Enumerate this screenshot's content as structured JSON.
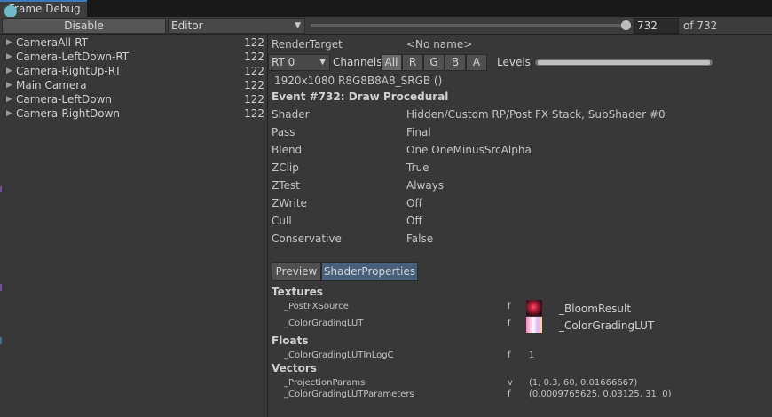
{
  "window": {
    "title": "Frame Debug"
  },
  "toolbar": {
    "disable_label": "Disable",
    "target_value": "Editor",
    "event_index": "732",
    "of_total": "of 732"
  },
  "tree": {
    "items": [
      {
        "name": "CameraAll-RT",
        "count": "122"
      },
      {
        "name": "Camera-LeftDown-RT",
        "count": "122"
      },
      {
        "name": "Camera-RightUp-RT",
        "count": "122"
      },
      {
        "name": "Main Camera",
        "count": "122"
      },
      {
        "name": "Camera-LeftDown",
        "count": "122"
      },
      {
        "name": "Camera-RightDown",
        "count": "122"
      }
    ]
  },
  "details": {
    "render_target_label": "RenderTarget",
    "render_target_value": "<No name>",
    "rt_select": "RT 0",
    "channels_label": "Channels",
    "channels": [
      "All",
      "R",
      "G",
      "B",
      "A"
    ],
    "levels_label": "Levels",
    "format": "1920x1080 R8G8B8A8_SRGB ()",
    "event_title": "Event #732: Draw Procedural",
    "properties": [
      {
        "label": "Shader",
        "value": "Hidden/Custom RP/Post FX Stack, SubShader #0"
      },
      {
        "label": "Pass",
        "value": "Final"
      },
      {
        "label": "Blend",
        "value": "One OneMinusSrcAlpha"
      },
      {
        "label": "ZClip",
        "value": "True"
      },
      {
        "label": "ZTest",
        "value": "Always"
      },
      {
        "label": "ZWrite",
        "value": "Off"
      },
      {
        "label": "Cull",
        "value": "Off"
      },
      {
        "label": "Conservative",
        "value": "False"
      }
    ],
    "tabs": [
      "Preview",
      "ShaderProperties"
    ],
    "textures_label": "Textures",
    "textures": [
      {
        "name": "_PostFXSource",
        "type": "f",
        "value": "_BloomResult"
      },
      {
        "name": "_ColorGradingLUT",
        "type": "f",
        "value": "_ColorGradingLUT"
      }
    ],
    "floats_label": "Floats",
    "floats": [
      {
        "name": "_ColorGradingLUTInLogC",
        "type": "f",
        "value": "1"
      }
    ],
    "vectors_label": "Vectors",
    "vectors": [
      {
        "name": "_ProjectionParams",
        "type": "v",
        "value": "(1, 0.3, 60, 0.01666667)"
      },
      {
        "name": "_ColorGradingLUTParameters",
        "type": "f",
        "value": "(0.0009765625, 0.03125, 31, 0)"
      }
    ]
  },
  "colors": {
    "selected_tab": "#46607c",
    "accent": "#3a79bb",
    "background": "#383838"
  }
}
